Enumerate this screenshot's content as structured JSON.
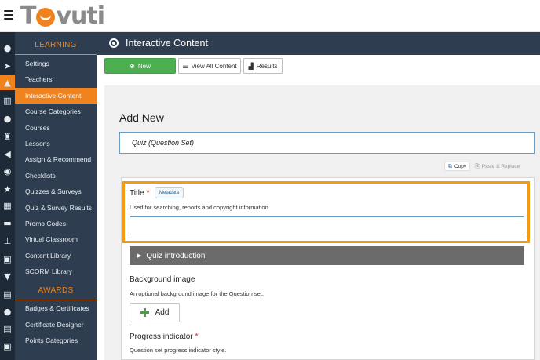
{
  "app": {
    "logo_text": "Tovuti"
  },
  "iconrail": {
    "icons": [
      "home-icon",
      "rocket-icon",
      "graduation-cap-icon",
      "bar-chart-icon",
      "users-icon",
      "trophy-icon",
      "megaphone-icon",
      "rss-icon",
      "star-icon",
      "table-icon",
      "credit-card-icon",
      "sitemap-icon",
      "id-card-icon",
      "cart-icon",
      "calendar-icon",
      "chat-icon",
      "document-icon",
      "contacts-icon"
    ],
    "glyphs": [
      "●",
      "➤",
      "▲",
      "▥",
      "●",
      "♜",
      "◀",
      "◉",
      "★",
      "▦",
      "▬",
      "⊥",
      "▣",
      "▼",
      "▤",
      "●",
      "▤",
      "▣"
    ],
    "active_index": 2
  },
  "sidebar": {
    "section_learning": "LEARNING",
    "section_awards": "AWARDS",
    "items": [
      {
        "label": "Settings"
      },
      {
        "label": "Teachers"
      },
      {
        "label": "Interactive Content"
      },
      {
        "label": "Course Categories"
      },
      {
        "label": "Courses"
      },
      {
        "label": "Lessons"
      },
      {
        "label": "Assign & Recommend"
      },
      {
        "label": "Checklists"
      },
      {
        "label": "Quizzes & Surveys"
      },
      {
        "label": "Quiz & Survey Results"
      },
      {
        "label": "Promo Codes"
      },
      {
        "label": "Virtual Classroom"
      },
      {
        "label": "Content Library"
      },
      {
        "label": "SCORM Library"
      }
    ],
    "award_items": [
      {
        "label": "Badges & Certificates"
      },
      {
        "label": "Certificate Designer"
      },
      {
        "label": "Points Categories"
      }
    ]
  },
  "header": {
    "title": "Interactive Content"
  },
  "toolbar": {
    "new_label": "New",
    "view_all_label": "View All Content",
    "results_label": "Results"
  },
  "main": {
    "heading": "Add New",
    "content_type": "Quiz (Question Set)",
    "copy_label": "Copy",
    "paste_label": "Paste & Replace"
  },
  "form": {
    "title_label": "Title",
    "required_mark": "*",
    "metadata_label": "Metadata",
    "title_help": "Used for searching, reports and copyright information",
    "title_value": "",
    "quiz_intro_label": "Quiz introduction",
    "bg_image_label": "Background image",
    "bg_image_help": "An optional background image for the Question set.",
    "add_label": "Add",
    "progress_label": "Progress indicator",
    "progress_help": "Question set progress indicator style."
  },
  "colors": {
    "accent": "#f0831e",
    "sidebar": "#2e3e50",
    "rail": "#1e2a38",
    "highlight": "#f29b14",
    "new_button": "#4caf50"
  }
}
